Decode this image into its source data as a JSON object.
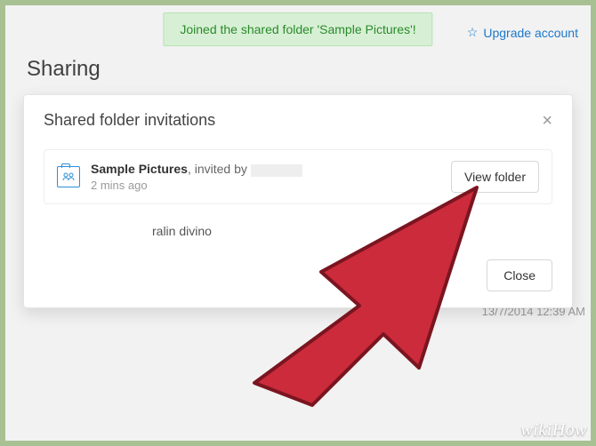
{
  "page": {
    "title": "Sharing",
    "upgrade_label": "Upgrade account"
  },
  "toast": {
    "message": "Joined the shared folder 'Sample Pictures'!"
  },
  "modal": {
    "title": "Shared folder invitations",
    "invitation": {
      "folder_name": "Sample Pictures",
      "invited_by_prefix": ", invited by ",
      "time": "2 mins ago",
      "view_button": "View folder"
    },
    "subname": "ralin divino",
    "close_button": "Close"
  },
  "background": {
    "timestamp": "13/7/2014 12:39 AM"
  },
  "watermark": "wikiHow"
}
